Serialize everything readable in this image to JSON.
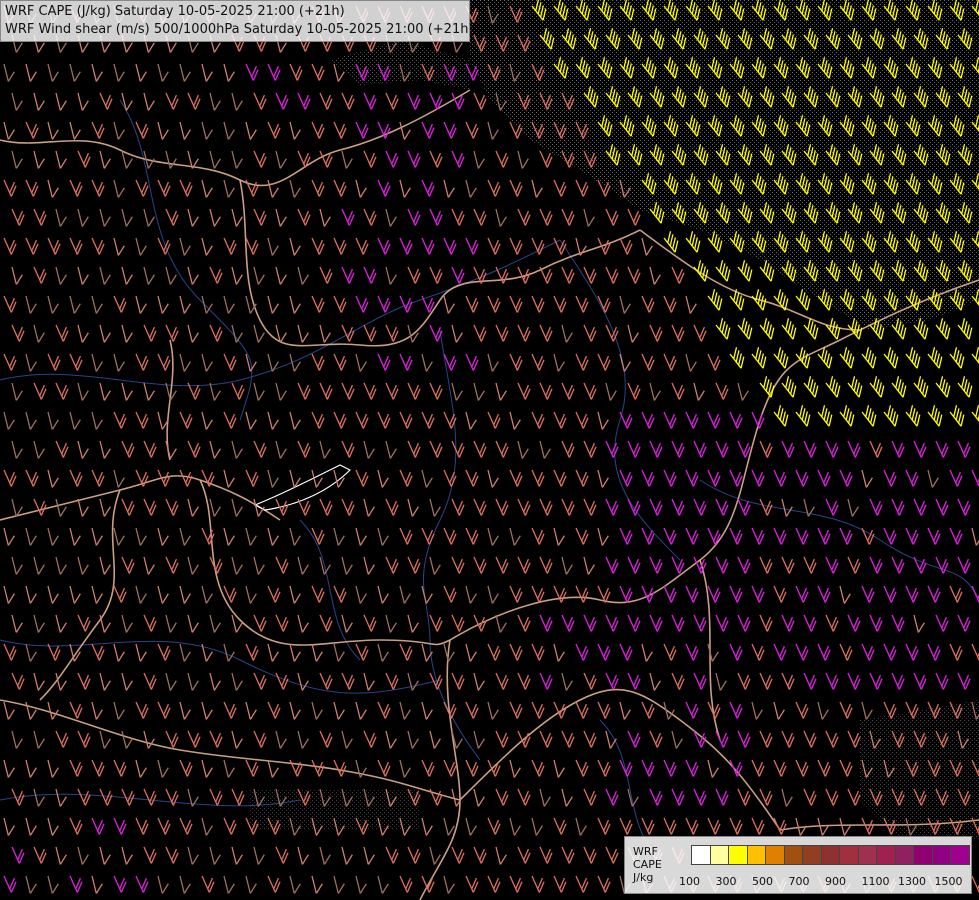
{
  "title_line_1": "WRF CAPE (J/kg) Saturday 10-05-2025 21:00 (+21h)",
  "title_line_2": "WRF Wind shear (m/s) 500/1000hPa Saturday 10-05-2025 21:00 (+21h)",
  "legend": {
    "line_1": "WRF",
    "line_2": "CAPE",
    "line_3": "J/kg",
    "tick_labels": [
      "100",
      "300",
      "500",
      "700",
      "900",
      "1100",
      "1300",
      "1500"
    ],
    "colors": [
      "#ffffff",
      "#ffffa0",
      "#ffff00",
      "#ffc000",
      "#e08000",
      "#a05010",
      "#904020",
      "#903030",
      "#a03040",
      "#a03050",
      "#a02050",
      "#902060",
      "#900070",
      "#900080",
      "#a00090"
    ]
  },
  "barb_colors": {
    "low_shear": "#d08070",
    "grey_shear": "#a07060",
    "salmon": "#e07060",
    "magenta": "#e020e0",
    "yellow": "#ffff00"
  },
  "border_color": "#e0b090",
  "river_color": "#3050a0"
}
